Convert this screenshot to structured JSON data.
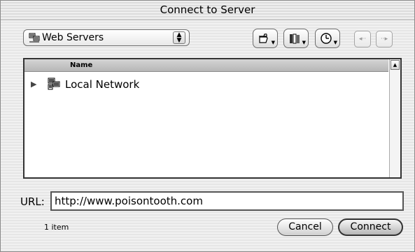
{
  "window": {
    "title": "Connect to Server"
  },
  "toolbar": {
    "location_popup": {
      "selected": "Web Servers",
      "icon": "network-icon"
    },
    "actions_icon": "pointing-hand-icon",
    "shortcuts_icon": "books-icon",
    "recent_icon": "clock-icon",
    "back_icon": "back-arrow-icon",
    "forward_icon": "forward-arrow-icon"
  },
  "browser": {
    "column_header": "Name",
    "items": [
      {
        "label": "Local Network",
        "icon": "local-network-icon"
      }
    ]
  },
  "url": {
    "label": "URL:",
    "value": "http://www.poisontooth.com"
  },
  "status": {
    "count": "1 item"
  },
  "buttons": {
    "cancel": "Cancel",
    "connect": "Connect"
  }
}
